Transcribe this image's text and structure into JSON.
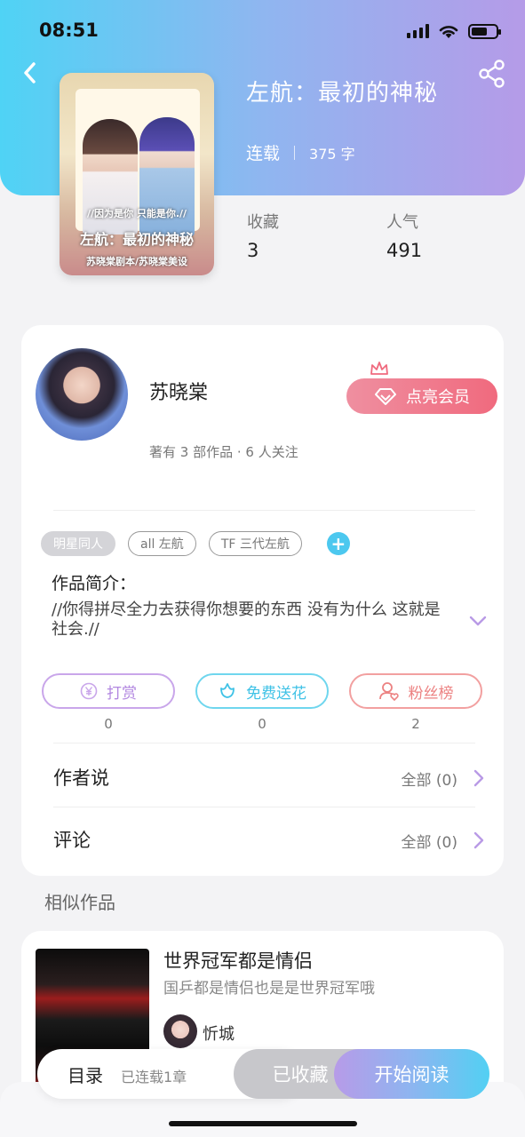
{
  "status_bar": {
    "time": "08:51"
  },
  "book": {
    "title": "左航：最初的神秘",
    "status": "连载",
    "word_count": "375 字",
    "cover": {
      "line1": "//因为是你 只能是你.//",
      "line2": "左航：最初的神秘",
      "line3": "苏晓棠剧本/苏晓棠美设"
    },
    "stats": [
      {
        "label": "收藏",
        "value": "3"
      },
      {
        "label": "人气",
        "value": "491"
      }
    ]
  },
  "author": {
    "name": "苏晓棠",
    "info": "著有 3 部作品 · 6 人关注",
    "vip_button": "点亮会员"
  },
  "tags": [
    "明星同人",
    "all 左航",
    "TF 三代左航"
  ],
  "intro": {
    "label": "作品简介：",
    "text": "//你得拼尽全力去获得你想要的东西 没有为什么 这就是社会.//"
  },
  "actions": [
    {
      "label": "打赏",
      "count": "0",
      "icon": "yen-icon"
    },
    {
      "label": "免费送花",
      "count": "0",
      "icon": "flower-icon"
    },
    {
      "label": "粉丝榜",
      "count": "2",
      "icon": "fans-icon"
    }
  ],
  "sections": [
    {
      "label": "作者说",
      "right": "全部 (0)"
    },
    {
      "label": "评论",
      "right": "全部 (0)"
    }
  ],
  "similar": {
    "title": "相似作品",
    "items": [
      {
        "name": "世界冠军都是情侣",
        "desc": "国乒都是情侣也是是世界冠军哦",
        "author": "忻城"
      }
    ]
  },
  "bottom": {
    "toc_label": "目录",
    "toc_status": "已连载1章",
    "fav_button": "已收藏",
    "read_button": "开始阅读"
  },
  "colors": {
    "header_gradient_start": "#4fd3f5",
    "header_gradient_end": "#b59be8",
    "vip_pink": "#f06a7e",
    "accent_cyan": "#4cc8ef",
    "accent_purple": "#b287e0"
  }
}
